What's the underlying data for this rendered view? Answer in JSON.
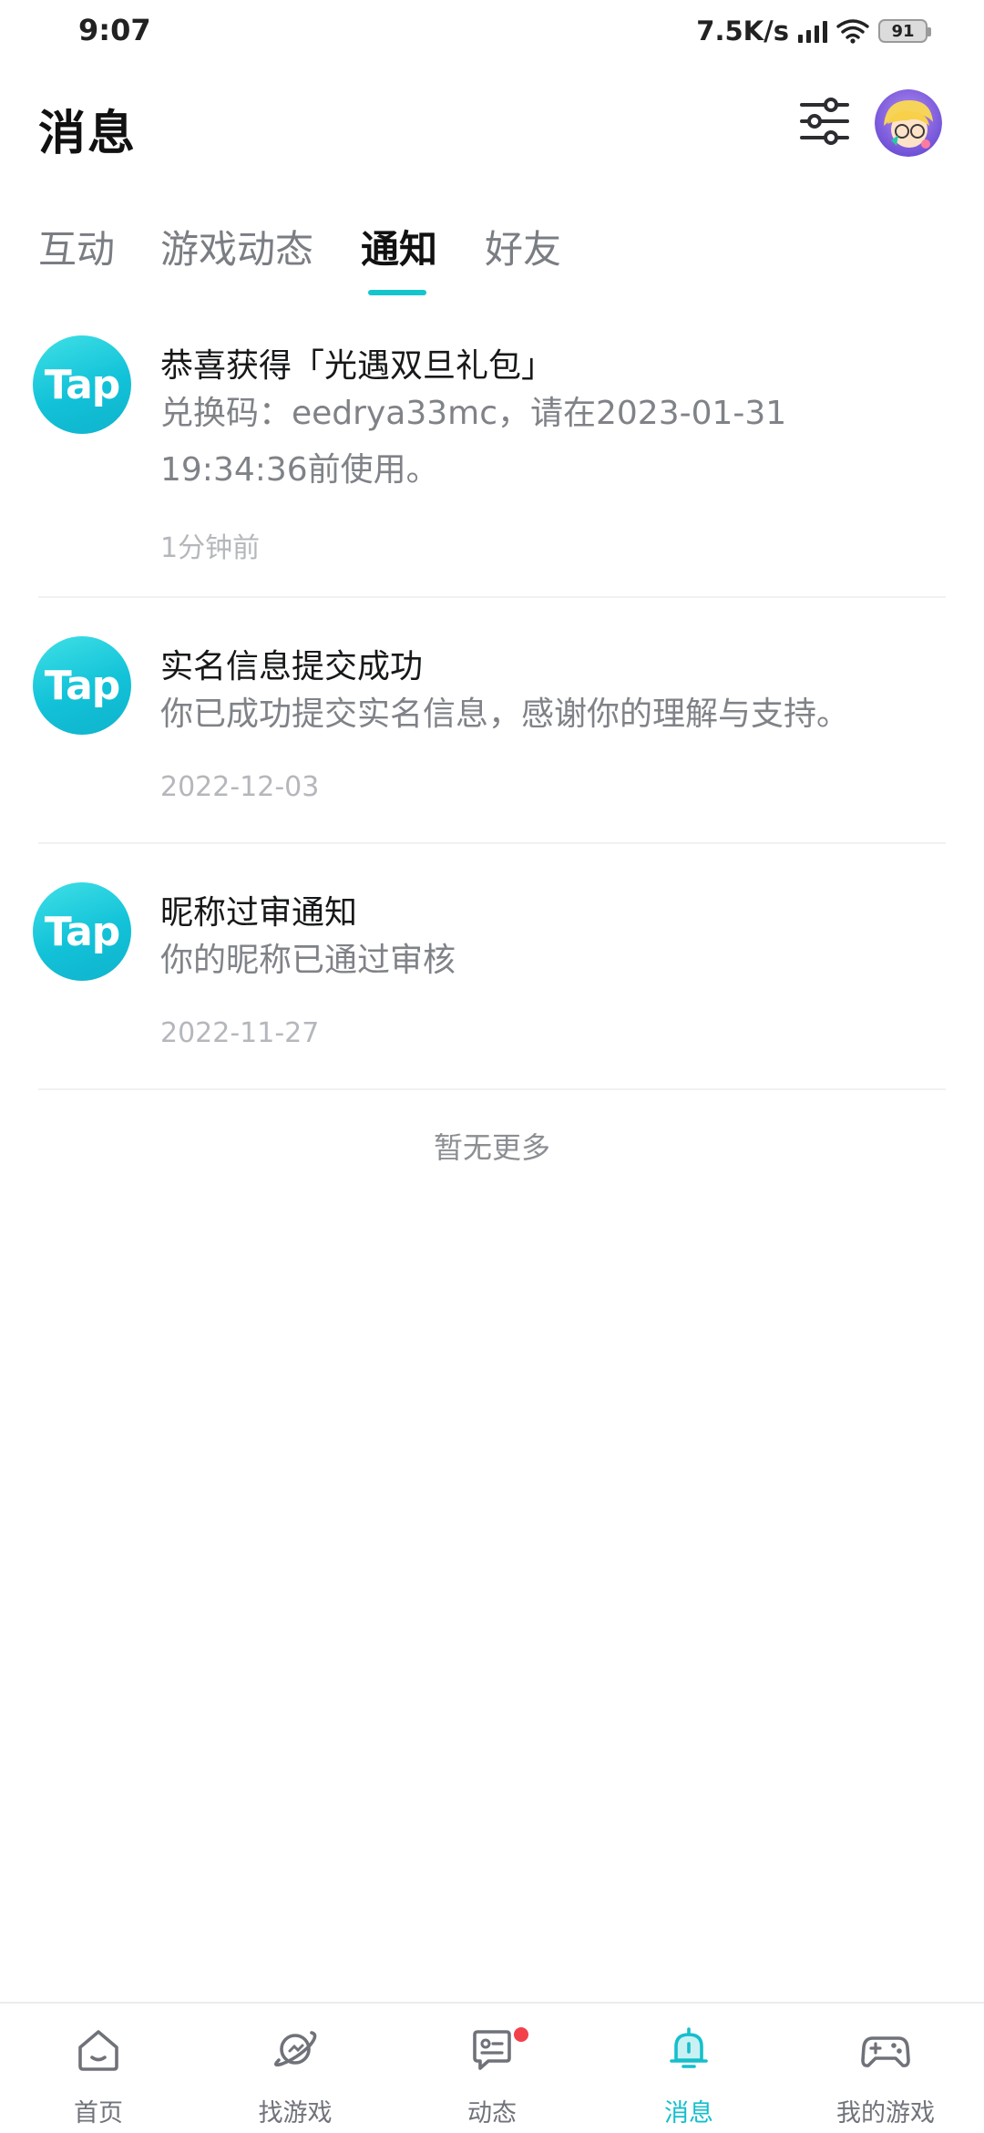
{
  "status_bar": {
    "time": "9:07",
    "net_speed": "7.5K/s",
    "battery": "91"
  },
  "header": {
    "title": "消息",
    "filter_icon": "sliders-icon",
    "avatar_icon": "user-avatar"
  },
  "tabs": [
    {
      "label": "互动",
      "active": false
    },
    {
      "label": "游戏动态",
      "active": false
    },
    {
      "label": "通知",
      "active": true
    },
    {
      "label": "好友",
      "active": false
    }
  ],
  "notifications": [
    {
      "logo_text": "Tap",
      "title": "恭喜获得「光遇双旦礼包」",
      "body": "兑换码：eedrya33mc，请在2023-01-31 19:34:36前使用。",
      "time": "1分钟前"
    },
    {
      "logo_text": "Tap",
      "title": "实名信息提交成功",
      "body": "你已成功提交实名信息，感谢你的理解与支持。",
      "time": "2022-12-03"
    },
    {
      "logo_text": "Tap",
      "title": "昵称过审通知",
      "body": "你的昵称已通过审核",
      "time": "2022-11-27"
    }
  ],
  "no_more": "暂无更多",
  "bottom_nav": [
    {
      "label": "首页",
      "icon": "home-icon",
      "active": false
    },
    {
      "label": "找游戏",
      "icon": "planet-icon",
      "active": false
    },
    {
      "label": "动态",
      "icon": "chat-bubble-icon",
      "active": false,
      "badge": true
    },
    {
      "label": "消息",
      "icon": "bell-icon",
      "active": true
    },
    {
      "label": "我的游戏",
      "icon": "gamepad-icon",
      "active": false
    }
  ],
  "colors": {
    "accent": "#15C5CE",
    "badge": "#F2414A",
    "text_primary": "#16181A",
    "text_secondary": "#7F8287",
    "text_tertiary": "#B4B7BB"
  }
}
